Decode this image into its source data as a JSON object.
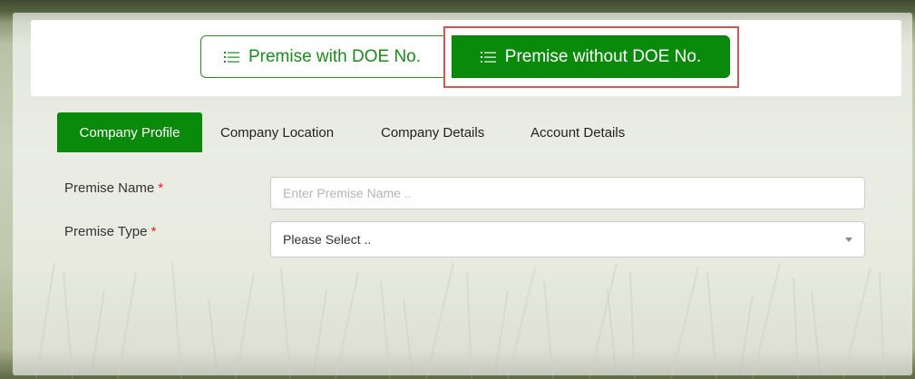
{
  "toggle": {
    "with_doe_label": "Premise with DOE No.",
    "without_doe_label": "Premise without DOE No.",
    "active": "without_doe"
  },
  "tabs": [
    {
      "label": "Company Profile",
      "active": true
    },
    {
      "label": "Company Location",
      "active": false
    },
    {
      "label": "Company Details",
      "active": false
    },
    {
      "label": "Account Details",
      "active": false
    }
  ],
  "form": {
    "premise_name": {
      "label": "Premise Name",
      "required_mark": "*",
      "placeholder": "Enter Premise Name ..",
      "value": ""
    },
    "premise_type": {
      "label": "Premise Type",
      "required_mark": "*",
      "selected": "Please Select .."
    }
  },
  "icons": {
    "toggle_icon": "list-icon",
    "select_caret": "chevron-down-icon"
  },
  "colors": {
    "accent": "#0a8a0a",
    "highlight": "#d9534f",
    "required": "#e02020"
  }
}
